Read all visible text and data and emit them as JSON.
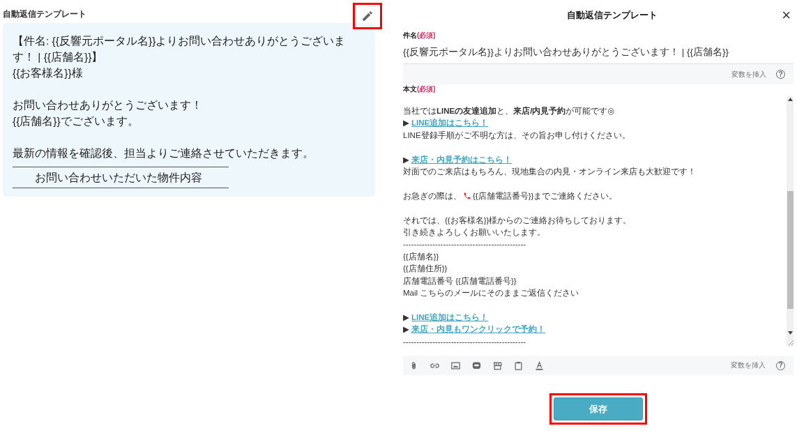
{
  "preview": {
    "title": "自動返信テンプレート",
    "highlighted_edit": true,
    "lines": [
      {
        "kind": "text",
        "text": "【件名: {{反響元ポータル名}}よりお問い合わせありがとうございます！ | {{店舗名}}】"
      },
      {
        "kind": "text",
        "text": "{{お客様名}}様"
      },
      {
        "kind": "blank"
      },
      {
        "kind": "text",
        "text": "お問い合わせありがとうございます！"
      },
      {
        "kind": "text",
        "text": "{{店舗名}}でございます。"
      },
      {
        "kind": "blank"
      },
      {
        "kind": "text",
        "text": "最新の情報を確認後、担当よりご連絡させていただきます。"
      },
      {
        "kind": "boxed",
        "text": "お問い合わせいただいた物件内容"
      }
    ]
  },
  "editor": {
    "title": "自動返信テンプレート",
    "close": "×",
    "subject": {
      "label": "件名",
      "required": "(必須)",
      "value": "{{反響元ポータル名}}よりお問い合わせありがとうございます！ | {{店舗名}}",
      "insert_variable": "変数を挿入",
      "help": "?"
    },
    "body": {
      "label": "本文",
      "required": "(必須)",
      "insert_variable": "変数を挿入",
      "help": "?",
      "lines": [
        {
          "kind": "text",
          "text": "当社では**LINEの友達追加**と、**来店/内見予約**が可能です◎"
        },
        {
          "kind": "link",
          "marker": "▶",
          "text": "LINE追加はこちら！"
        },
        {
          "kind": "text",
          "text": "LINE登録手順がご不明な方は、その旨お申し付けください。"
        },
        {
          "kind": "blank"
        },
        {
          "kind": "link",
          "marker": "▶",
          "text": "来店・内見予約はこちら！"
        },
        {
          "kind": "text",
          "text": "対面でのご来店はもちろん、現地集合の内見・オンライン来店も大歓迎です！"
        },
        {
          "kind": "blank"
        },
        {
          "kind": "phone",
          "before": "お急ぎの際は、",
          "after": "{{店舗電話番号}}までご連絡ください。"
        },
        {
          "kind": "blank"
        },
        {
          "kind": "text",
          "text": "それでは、{{お客様名}}様からのご連絡お待ちしております。"
        },
        {
          "kind": "text",
          "text": "引き続きよろしくお願いいたします。"
        },
        {
          "kind": "text",
          "text": "----------------------------------------------"
        },
        {
          "kind": "text",
          "text": "{{店舗名}}"
        },
        {
          "kind": "text",
          "text": "{{店舗住所}}"
        },
        {
          "kind": "text",
          "text": "店舗電話番号 {{店舗電話番号}}"
        },
        {
          "kind": "text",
          "text": "Mail こちらのメールにそのままご返信ください"
        },
        {
          "kind": "blank"
        },
        {
          "kind": "link",
          "marker": "▶",
          "text": "LINE追加はこちら！"
        },
        {
          "kind": "link",
          "marker": "▶",
          "text": "来店・内見もワンクリックで予約！"
        },
        {
          "kind": "text",
          "text": "----------------------------------------------"
        }
      ]
    },
    "save": {
      "label": "保存",
      "highlighted": true
    }
  }
}
